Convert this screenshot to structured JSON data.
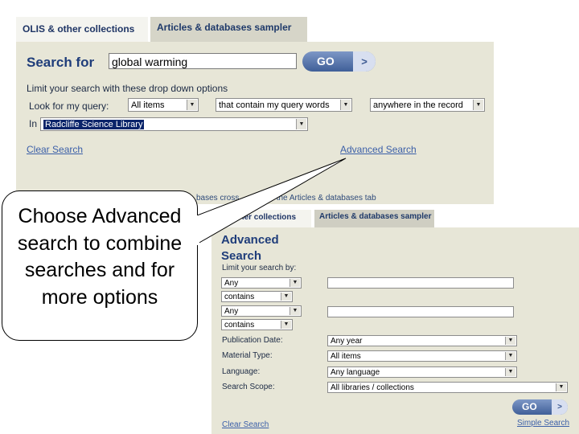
{
  "top": {
    "tabs": [
      "OLIS & other collections",
      "Articles & databases sampler"
    ],
    "search_for_label": "Search for",
    "search_value": "global warming",
    "go_label": "GO",
    "go_arrow": ">",
    "limit_label": "Limit your search with these drop down options",
    "lookfor_label": "Look for my query:",
    "select_items": "All items",
    "select_contain": "that contain my query words",
    "select_where": "anywhere in the record",
    "in_label": "In",
    "select_library": "Radcliffe Science Library",
    "clear_search": "Clear Search",
    "advanced_search": "Advanced Search",
    "cross_note": "bases cross",
    "cross_note2": "n the Articles & databases tab"
  },
  "callout_text": "Choose Advanced search to combine searches and for more options",
  "bottom": {
    "tabs": [
      "other collections",
      "Articles & databases sampler"
    ],
    "title_line1": "Advanced",
    "title_line2": "Search",
    "limit_label": "Limit your search by:",
    "any1": "Any",
    "contains1": "contains",
    "any2": "Any",
    "contains2": "contains",
    "pub_date_label": "Publication Date:",
    "pub_date_value": "Any year",
    "material_label": "Material Type:",
    "material_value": "All items",
    "language_label": "Language:",
    "language_value": "Any language",
    "scope_label": "Search Scope:",
    "scope_value": "All libraries / collections",
    "go_label": "GO",
    "go_arrow": ">",
    "clear_search": "Clear Search",
    "simple_search": "Simple Search"
  },
  "colors": {
    "panel_bg": "#e7e6d7",
    "title_blue": "#1f3d7a",
    "link_blue": "#3b5fa8",
    "go_blue": "#3f5f98",
    "highlight": "#0a246a"
  }
}
